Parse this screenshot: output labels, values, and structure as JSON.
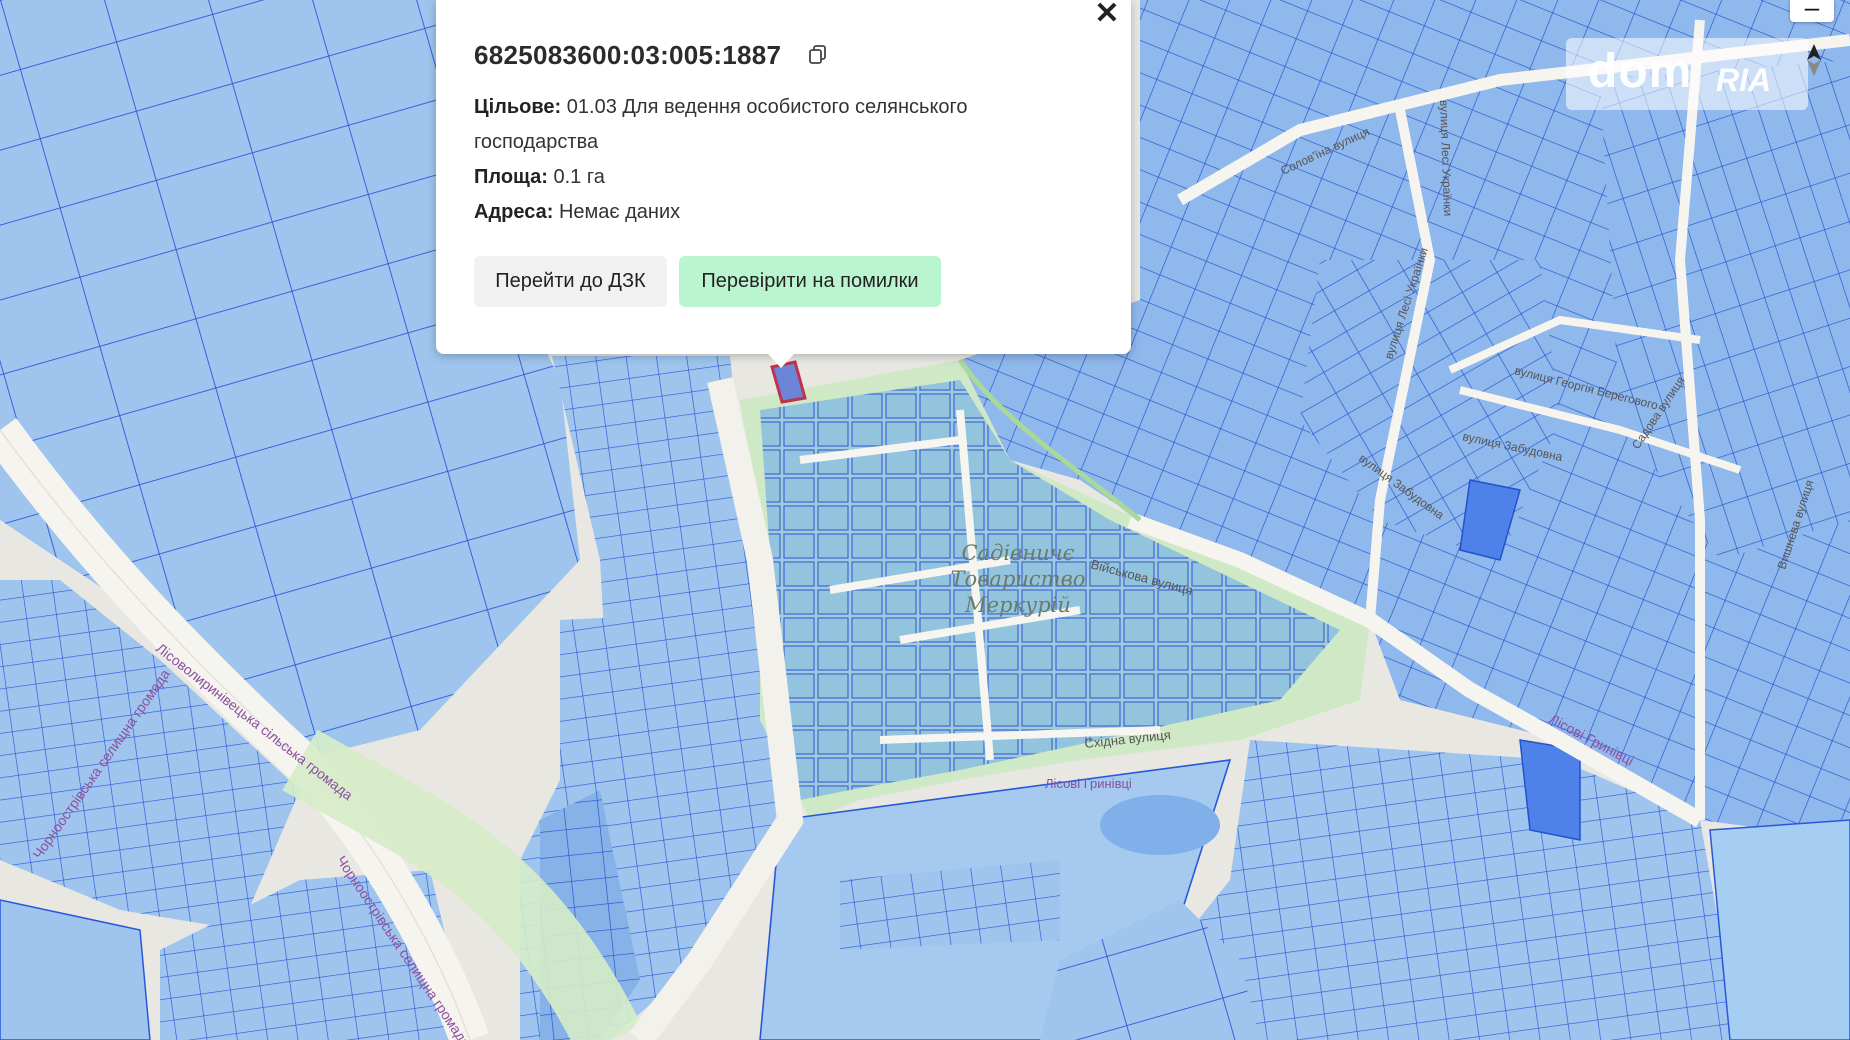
{
  "popup": {
    "cadastral_id": "6825083600:03:005:1887",
    "purpose_label": "Цільове:",
    "purpose_value_line1": "01.03 Для ведення особистого селянського",
    "purpose_value_line2": "господарства",
    "area_label": "Площа:",
    "area_value": "0.1 га",
    "address_label": "Адреса:",
    "address_value": "Немає даних",
    "btn_dzk": "Перейти до ДЗК",
    "btn_check": "Перевірити на помилки"
  },
  "map_labels": {
    "garden_society_line1": "Садівничє",
    "garden_society_line2": "Товариство",
    "garden_society_line3": "Меркурій",
    "street_viyskova": "Військова вулиця",
    "street_skhidna": "Східна вулиця",
    "street_lisovi_hrynivtsi": "Лісові Гринівці",
    "street_lisovi_hrynivtsi_2": "Лісові Гринівці",
    "street_lesi_ukrainky": "вулиця Лесі Українки",
    "street_lesi_ukrainky_2": "вулиця Лесі Українки",
    "street_solovina": "Солов'їна вулиця",
    "street_heorhiya_berehovoho": "вулиця Георгія Берегового",
    "street_zabudovna": "вулиця Забудовна",
    "street_zabudovna_2": "вулиця Забудовна",
    "street_sadova": "Садова вулиця",
    "street_vyshneva": "Вишнева вулиця",
    "hromada_lisovohrynivetska": "Лісоволиринівецька сільська громада",
    "hromada_chornoostrivska_1": "Чорноострівська селищна громада",
    "hromada_chornoostrivska_2": "Чорноострівська селищна громада"
  },
  "watermark": {
    "brand": "dom",
    "brand2": "RIA"
  },
  "colors": {
    "parcel_fill": "#9cc3ef",
    "parcel_stroke": "#2a57d8",
    "parcel_dark": "#6d9ff0",
    "garden_green": "#cfe9c6",
    "road": "#f5f3ee",
    "selected_parcel": "#c0334a",
    "button_check": "#b9f6cf"
  },
  "icons": [
    "copy-icon",
    "close-icon",
    "zoom-out-icon",
    "compass-icon"
  ]
}
